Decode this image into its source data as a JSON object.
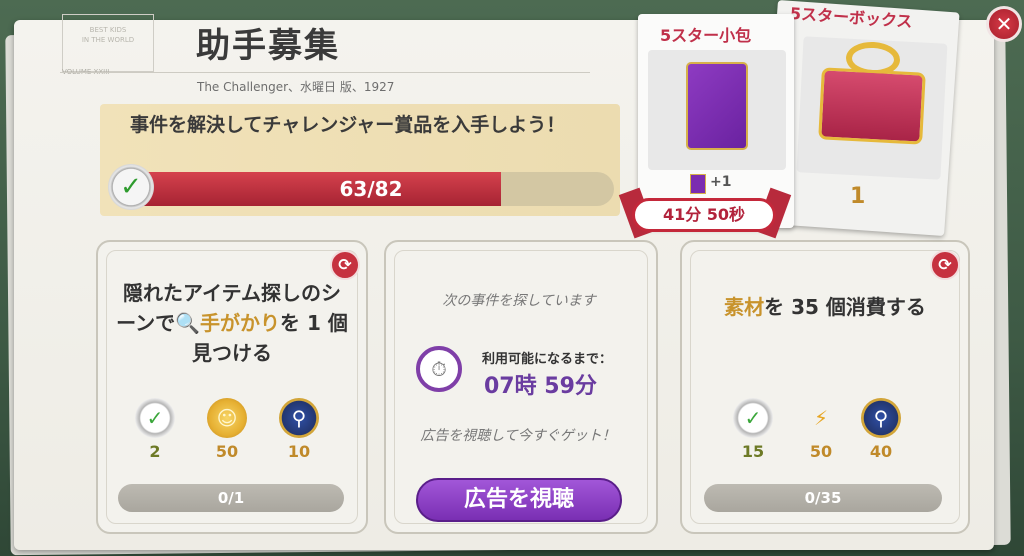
{
  "header": {
    "title": "助手募集",
    "dateline": "The Challenger、水曜日 版、1927",
    "masthead_lines": [
      "BEST KIDS",
      "IN THE WORLD"
    ],
    "masthead_sub": "VOLUME XXIII"
  },
  "challenge": {
    "text": "事件を解決してチャレンジャー賞品を入手しよう！",
    "progress_label": "63/82",
    "progress_current": 63,
    "progress_total": 82
  },
  "left_card": {
    "title_part1": "隠れたアイテム探しのシーンで",
    "title_highlight": "手がかり",
    "title_part2": "を 1 個見つける",
    "rewards": [
      {
        "icon": "check-plus-icon",
        "value": "2"
      },
      {
        "icon": "gold-coin-icon",
        "value": "50"
      },
      {
        "icon": "magnifier-medal-icon",
        "value": "10"
      }
    ],
    "progress": "0/1"
  },
  "middle_card": {
    "searching_text": "次の事件を探しています",
    "available_label": "利用可能になるまで：",
    "available_time": "07時 59分",
    "ad_text": "広告を視聴して今すぐゲット！",
    "watch_button": "広告を視聴"
  },
  "right_card": {
    "title_highlight": "素材",
    "title_rest": "を 35 個消費する",
    "rewards": [
      {
        "icon": "check-plus-icon",
        "value": "15"
      },
      {
        "icon": "lightning-icon",
        "value": "50"
      },
      {
        "icon": "magnifier-medal-icon",
        "value": "40"
      }
    ],
    "progress": "0/35"
  },
  "offers": {
    "pack_title": "5スター小包",
    "pack_bonus": "+1",
    "pack_timer": "41分 50秒",
    "box_title": "5スターボックス",
    "box_count": "1"
  },
  "colors": {
    "accent_red": "#c6313f",
    "progress_fill": "#d5424d",
    "purple": "#7a2fb3",
    "gold": "#c8932c"
  }
}
